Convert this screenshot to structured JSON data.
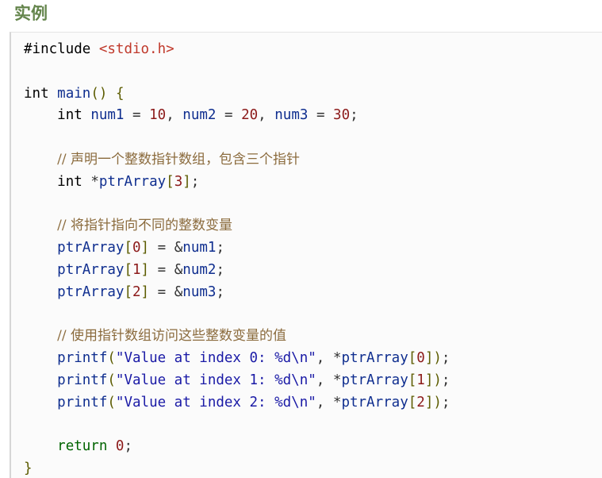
{
  "section_title": "实例",
  "code": {
    "language": "c",
    "lines": [
      "#include <stdio.h>",
      "",
      "int main() {",
      "    int num1 = 10, num2 = 20, num3 = 30;",
      "",
      "    // 声明一个整数指针数组，包含三个指针",
      "    int *ptrArray[3];",
      "",
      "    // 将指针指向不同的整数变量",
      "    ptrArray[0] = &num1;",
      "    ptrArray[1] = &num2;",
      "    ptrArray[2] = &num3;",
      "",
      "    // 使用指针数组访问这些整数变量的值",
      "    printf(\"Value at index 0: %d\\n\", *ptrArray[0]);",
      "    printf(\"Value at index 1: %d\\n\", *ptrArray[1]);",
      "    printf(\"Value at index 2: %d\\n\", *ptrArray[2]);",
      "",
      "    return 0;",
      "}"
    ]
  },
  "colors": {
    "title": "#64854c",
    "identifier": "#0f2e8f",
    "number": "#8c1a1a",
    "include_path": "#c0392b",
    "comment": "#8b6b3d",
    "code_background": "#fbfbfb"
  }
}
